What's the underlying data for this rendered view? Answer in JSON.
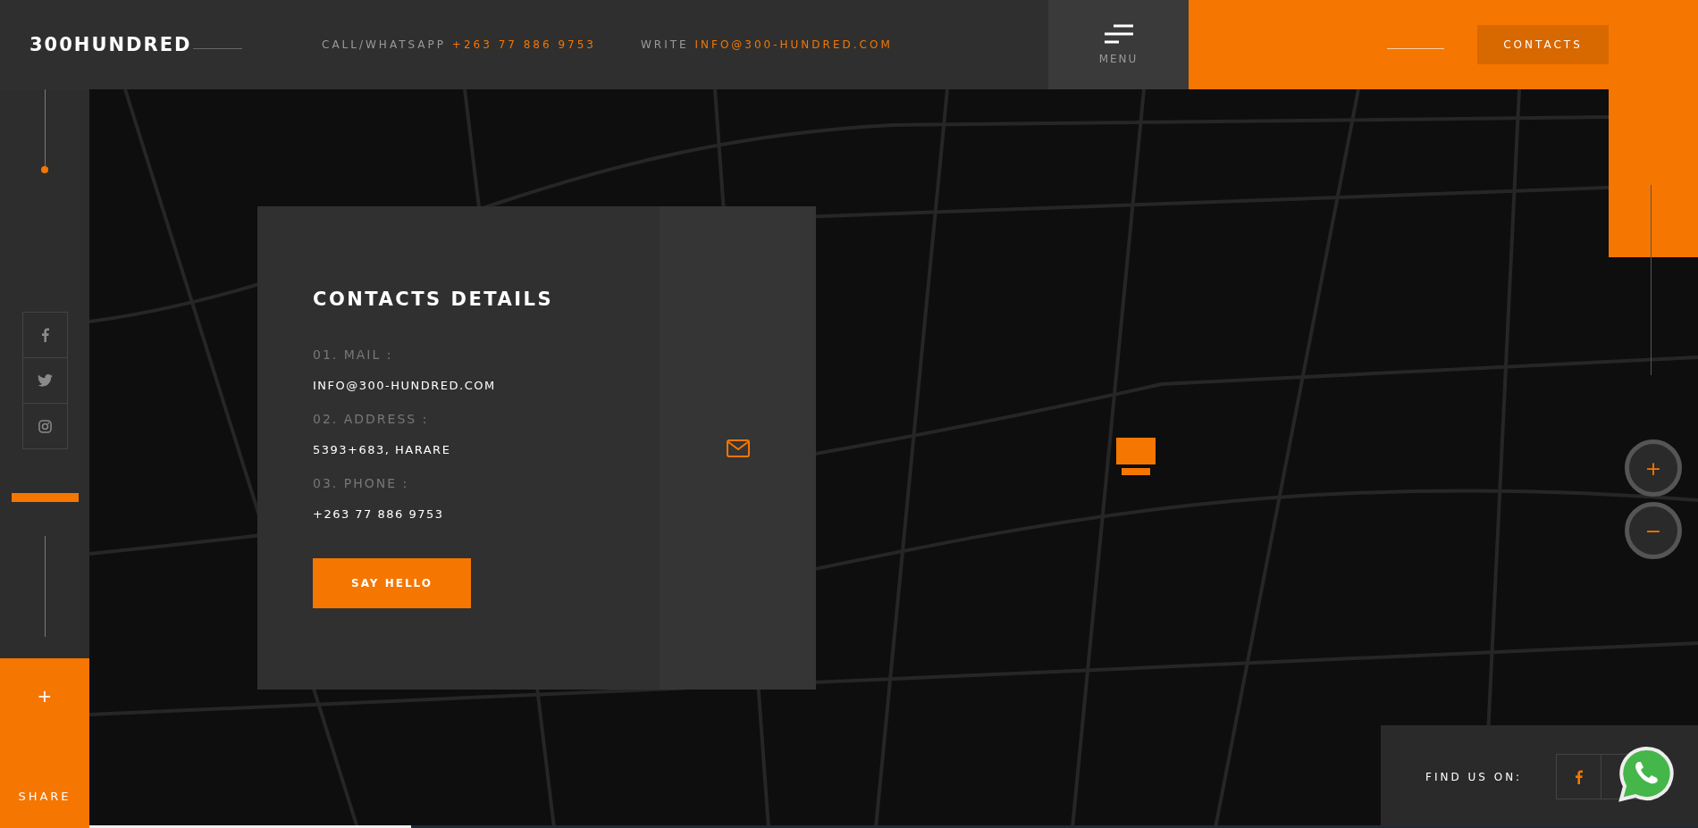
{
  "header": {
    "logo": "300HUNDRED",
    "contact_items": [
      {
        "label": "CALL/WHATSAPP",
        "value": "+263 77 886 9753"
      },
      {
        "label": "WRITE",
        "value": "INFO@300-HUNDRED.COM"
      }
    ],
    "menu_label": "MENU",
    "contacts_button": "CONTACTS"
  },
  "sidebar": {
    "social": [
      {
        "kind": "facebook"
      },
      {
        "kind": "twitter"
      },
      {
        "kind": "instagram"
      }
    ],
    "share_icon": "+",
    "share_label": "SHARE",
    "section_indicator": {
      "level": 1
    }
  },
  "contact_card": {
    "title": "CONTACTS DETAILS",
    "details": [
      {
        "label": "01. MAIL :",
        "value": "INFO@300-HUNDRED.COM"
      },
      {
        "label": "02. ADDRESS :",
        "value": "5393+683, HARARE"
      },
      {
        "label": "03. PHONE :",
        "value": "+263 77 886 9753"
      }
    ],
    "button": "SAY HELLO"
  },
  "map": {
    "zoom_in": "+",
    "zoom_out": "−"
  },
  "page_progress": {
    "level": 0.2
  },
  "find_us": {
    "label": "FIND US ON:",
    "links": [
      {
        "kind": "facebook"
      },
      {
        "kind": "empty"
      }
    ]
  }
}
